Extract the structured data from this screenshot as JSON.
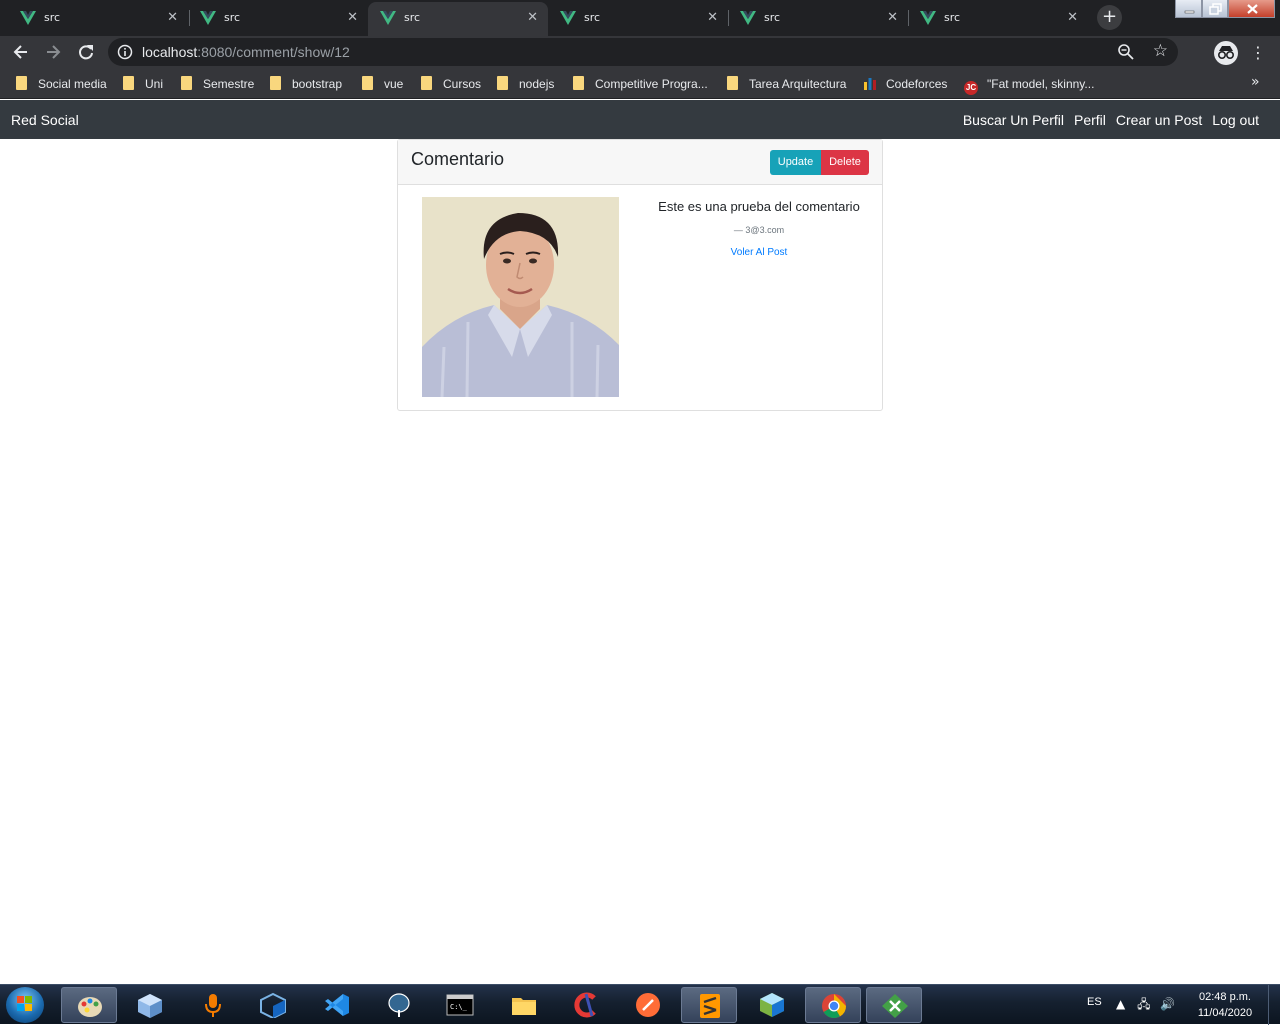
{
  "browser": {
    "tabs": [
      {
        "title": "src",
        "active": false
      },
      {
        "title": "src",
        "active": false
      },
      {
        "title": "src",
        "active": true
      },
      {
        "title": "src",
        "active": false
      },
      {
        "title": "src",
        "active": false
      },
      {
        "title": "src",
        "active": false
      }
    ],
    "url_host": "localhost",
    "url_path": ":8080/comment/show/12",
    "bookmarks": [
      {
        "label": "Social media",
        "icon": "folder-icon"
      },
      {
        "label": "Uni",
        "icon": "folder-icon"
      },
      {
        "label": "Semestre",
        "icon": "folder-icon"
      },
      {
        "label": "bootstrap",
        "icon": "folder-icon"
      },
      {
        "label": "vue",
        "icon": "folder-icon"
      },
      {
        "label": "Cursos",
        "icon": "folder-icon"
      },
      {
        "label": "nodejs",
        "icon": "folder-icon"
      },
      {
        "label": "Competitive Progra...",
        "icon": "folder-icon"
      },
      {
        "label": "Tarea Arquitectura",
        "icon": "folder-icon"
      },
      {
        "label": "Codeforces",
        "icon": "codeforces-icon"
      },
      {
        "label": "\"Fat model, skinny...",
        "icon": "jc-icon"
      }
    ],
    "more_bookmarks": "»"
  },
  "navbar": {
    "brand": "Red Social",
    "links": [
      "Buscar Un Perfil",
      "Perfil",
      "Crear un Post",
      "Log out"
    ]
  },
  "card": {
    "title": "Comentario",
    "update_label": "Update",
    "delete_label": "Delete",
    "comment_text": "Este es una prueba del comentario",
    "author": "— 3@3.com",
    "back_link": "Voler Al Post"
  },
  "taskbar": {
    "language": "ES",
    "time": "02:48 p.m.",
    "date": "11/04/2020"
  }
}
